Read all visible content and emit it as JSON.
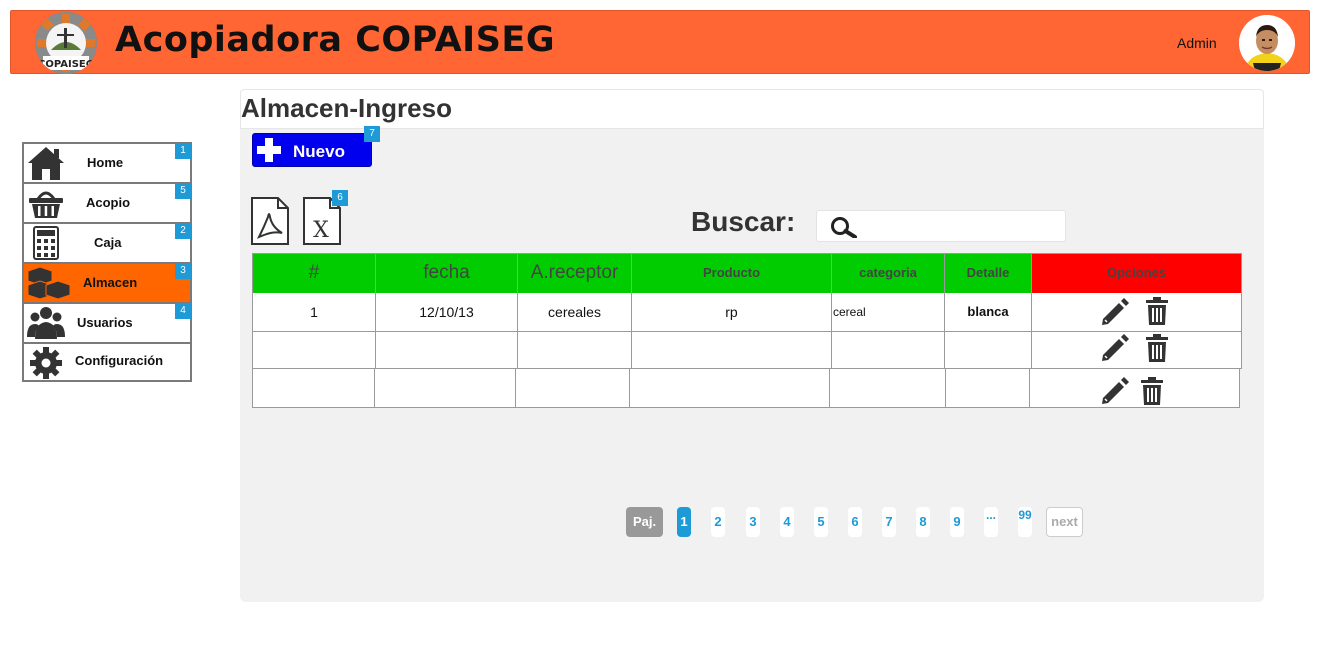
{
  "header": {
    "app_title": "Acopiadora COPAISEG",
    "logo_text": "COPAISEG",
    "user_name": "Admin"
  },
  "sidebar": {
    "items": [
      {
        "label": "Home",
        "badge": "1",
        "icon": "home-icon"
      },
      {
        "label": "Acopio",
        "badge": "5",
        "icon": "basket-icon"
      },
      {
        "label": "Caja",
        "badge": "2",
        "icon": "calculator-icon"
      },
      {
        "label": "Almacen",
        "badge": "3",
        "icon": "boxes-icon",
        "active": true
      },
      {
        "label": "Usuarios",
        "badge": "4",
        "icon": "users-icon"
      },
      {
        "label": "Configuración",
        "badge": "",
        "icon": "gear-icon"
      }
    ]
  },
  "main": {
    "page_title": "Almacen-Ingreso",
    "new_button": {
      "label": "Nuevo",
      "badge": "7"
    },
    "export": {
      "pdf_icon": "pdf-file-icon",
      "excel_icon": "excel-file-icon",
      "badge": "6"
    },
    "search": {
      "label": "Buscar:",
      "value": ""
    }
  },
  "table": {
    "columns": [
      "#",
      "fecha",
      "A.receptor",
      "Producto",
      "categoria",
      "Detalle",
      "Opciones"
    ],
    "rows": [
      [
        "1",
        "12/10/13",
        "cereales",
        "rp",
        "cereal",
        "blanca"
      ],
      [
        "",
        "",
        "",
        "",
        "",
        ""
      ],
      [
        "",
        "",
        "",
        "",
        "",
        ""
      ]
    ],
    "row_actions": [
      "edit-icon",
      "trash-icon"
    ]
  },
  "pager": {
    "label": "Paj.",
    "pages": [
      "1",
      "2",
      "3",
      "4",
      "5",
      "6",
      "7",
      "8",
      "9"
    ],
    "ellipsis": "...",
    "last": "99",
    "next": "next",
    "current": "1"
  },
  "colors": {
    "header": "#ff6633",
    "active_item": "#ff6600",
    "new_button": "#0000ee",
    "table_header": "#00cc00",
    "options_header": "#ff0000",
    "badge": "#1e9ad6",
    "page_link": "#1e9ad6"
  }
}
